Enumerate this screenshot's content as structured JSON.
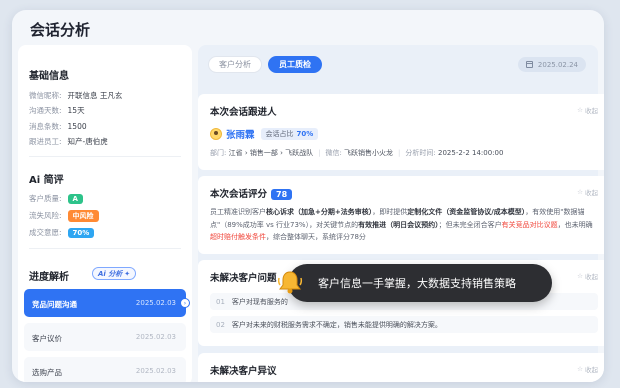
{
  "app": {
    "title": "会话分析"
  },
  "basic": {
    "heading": "基础信息",
    "rows": [
      {
        "key": "微信昵称:",
        "value": "开联信息 王凡玄"
      },
      {
        "key": "沟通天数:",
        "value": "15天"
      },
      {
        "key": "消息条数:",
        "value": "1500"
      },
      {
        "key": "跟进员工:",
        "value": "知产-唐伯虎"
      }
    ]
  },
  "ai_review": {
    "heading": "Ai 简评",
    "quality_label": "客户质量:",
    "quality_value": "A",
    "risk_label": "流失风险:",
    "risk_value": "中风险",
    "intent_label": "成交意愿:",
    "intent_value": "70%"
  },
  "progress": {
    "heading": "进度解析",
    "ai_badge": "Ai 分析",
    "items": [
      {
        "label": "竞品问题沟通",
        "date": "2025.02.03"
      },
      {
        "label": "客户议价",
        "date": "2025.02.03"
      },
      {
        "label": "选购产品",
        "date": "2025.02.03"
      }
    ]
  },
  "tabs": {
    "customer": "客户分析",
    "staff": "员工质检"
  },
  "date": "2025.02.24",
  "card_follow": {
    "title": "本次会话跟进人",
    "collapse": "收起",
    "name": "张雨霖",
    "ratio_label": "会话占比",
    "ratio_value": "70%",
    "dept_label": "部门:",
    "dept_value": "江省 › 销售一部 › 飞跃战队",
    "wechat_label": "微信:",
    "wechat_value": "飞跃销售小火龙",
    "time_label": "分析时间:",
    "time_value": "2025-2-2 14:00:00"
  },
  "card_score": {
    "title": "本次会话评分",
    "score": "78",
    "collapse": "收起",
    "p1": "员工精准识别客户",
    "b1": "核心诉求（加急+分期+法务审核）",
    "p2": "，即时提供",
    "b2": "定制化文件（资金监管协议/成本模型）",
    "p3": "，有效使用\"数据锚点\"（89%成功率 vs 行业73%），对关键节点的",
    "b3": "有效推进（明日会议预约）",
    "p4": "；但未完全闭合客户",
    "r1": "有关竞品对比议题",
    "p5": "，也未明确",
    "r2": "超时赔付触发条件",
    "p6": "，综合整体聊天，系统评分78分"
  },
  "card_unresolved": {
    "title": "未解决客户问题",
    "collapse": "收起",
    "items": [
      {
        "num": "01",
        "text": "客户对现有服务的"
      },
      {
        "num": "02",
        "text": "客户对未来的财税服务需求不确定，销售未能提供明确的解决方案。"
      }
    ]
  },
  "card_objection": {
    "title": "未解决客户异议",
    "collapse": "收起"
  },
  "toast": {
    "text": "客户信息一手掌握，大数据支持销售策略"
  }
}
